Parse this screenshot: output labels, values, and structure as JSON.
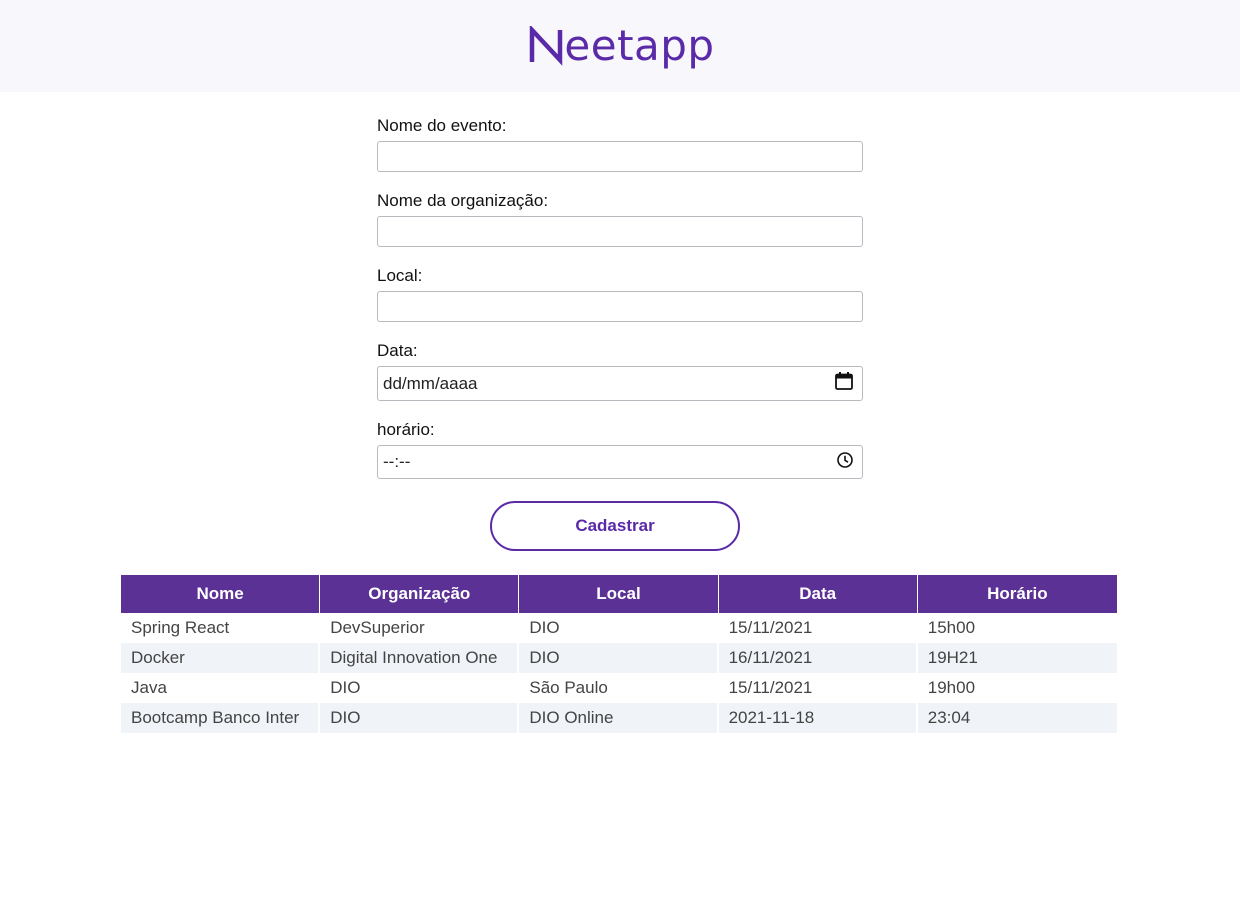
{
  "header": {
    "logo_text": "eetapp",
    "logo_full": "Meetapp",
    "brand_color": "#5a2aa8"
  },
  "form": {
    "fields": [
      {
        "label": "Nome do evento:",
        "value": ""
      },
      {
        "label": "Nome da organização:",
        "value": ""
      },
      {
        "label": "Local:",
        "value": ""
      },
      {
        "label": "Data:",
        "value": "dd/mm/aaaa",
        "icon": "calendar-icon"
      },
      {
        "label": "horário:",
        "value": "--:--",
        "icon": "clock-icon"
      }
    ],
    "submit_label": "Cadastrar"
  },
  "table": {
    "header_color": "#5b3196",
    "columns": [
      "Nome",
      "Organização",
      "Local",
      "Data",
      "Horário"
    ],
    "rows": [
      [
        "Spring React",
        "DevSuperior",
        "DIO",
        "15/11/2021",
        "15h00"
      ],
      [
        "Docker",
        "Digital Innovation One",
        "DIO",
        "16/11/2021",
        "19H21"
      ],
      [
        "Java",
        "DIO",
        "São Paulo",
        "15/11/2021",
        "19h00"
      ],
      [
        "Bootcamp Banco Inter",
        "DIO",
        "DIO Online",
        "2021-11-18",
        "23:04"
      ]
    ]
  }
}
